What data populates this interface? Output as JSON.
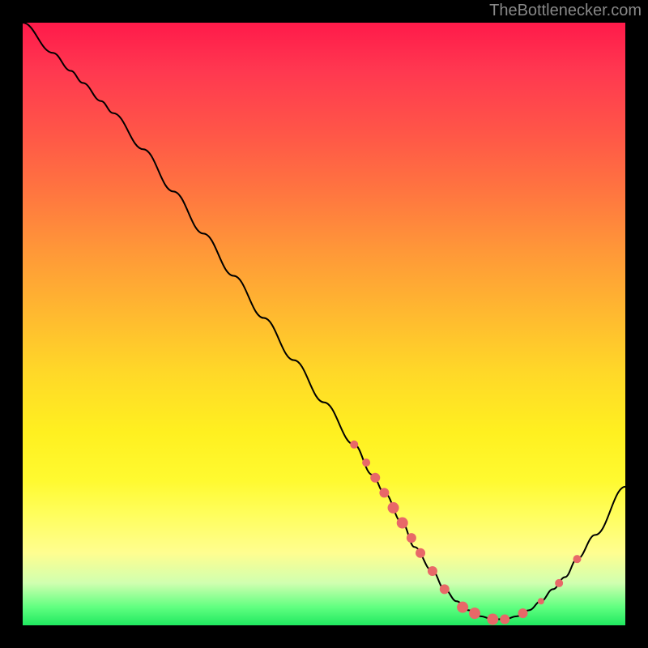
{
  "watermark": "TheBottlenecker.com",
  "chart_data": {
    "type": "line",
    "title": "",
    "xlabel": "",
    "ylabel": "",
    "xlim": [
      0,
      100
    ],
    "ylim": [
      0,
      100
    ],
    "curve_points": [
      {
        "x": 0,
        "y": 100
      },
      {
        "x": 5,
        "y": 95
      },
      {
        "x": 8,
        "y": 92
      },
      {
        "x": 10,
        "y": 90
      },
      {
        "x": 13,
        "y": 87
      },
      {
        "x": 15,
        "y": 85
      },
      {
        "x": 20,
        "y": 79
      },
      {
        "x": 25,
        "y": 72
      },
      {
        "x": 30,
        "y": 65
      },
      {
        "x": 35,
        "y": 58
      },
      {
        "x": 40,
        "y": 51
      },
      {
        "x": 45,
        "y": 44
      },
      {
        "x": 50,
        "y": 37
      },
      {
        "x": 55,
        "y": 30
      },
      {
        "x": 58,
        "y": 25
      },
      {
        "x": 60,
        "y": 22
      },
      {
        "x": 63,
        "y": 17
      },
      {
        "x": 65,
        "y": 13
      },
      {
        "x": 68,
        "y": 9
      },
      {
        "x": 70,
        "y": 6
      },
      {
        "x": 72,
        "y": 4
      },
      {
        "x": 74,
        "y": 2.5
      },
      {
        "x": 76,
        "y": 1.5
      },
      {
        "x": 78,
        "y": 1
      },
      {
        "x": 80,
        "y": 1
      },
      {
        "x": 82,
        "y": 1.5
      },
      {
        "x": 84,
        "y": 2.5
      },
      {
        "x": 86,
        "y": 4
      },
      {
        "x": 88,
        "y": 6
      },
      {
        "x": 90,
        "y": 8
      },
      {
        "x": 92,
        "y": 11
      },
      {
        "x": 95,
        "y": 15
      },
      {
        "x": 100,
        "y": 23
      }
    ],
    "data_points": [
      {
        "x": 55,
        "y": 30,
        "size": 5
      },
      {
        "x": 57,
        "y": 27,
        "size": 5
      },
      {
        "x": 58.5,
        "y": 24.5,
        "size": 6
      },
      {
        "x": 60,
        "y": 22,
        "size": 6
      },
      {
        "x": 61.5,
        "y": 19.5,
        "size": 7
      },
      {
        "x": 63,
        "y": 17,
        "size": 7
      },
      {
        "x": 64.5,
        "y": 14.5,
        "size": 6
      },
      {
        "x": 66,
        "y": 12,
        "size": 6
      },
      {
        "x": 68,
        "y": 9,
        "size": 6
      },
      {
        "x": 70,
        "y": 6,
        "size": 6
      },
      {
        "x": 73,
        "y": 3,
        "size": 7
      },
      {
        "x": 75,
        "y": 2,
        "size": 7
      },
      {
        "x": 78,
        "y": 1,
        "size": 7
      },
      {
        "x": 80,
        "y": 1,
        "size": 6
      },
      {
        "x": 83,
        "y": 2,
        "size": 6
      },
      {
        "x": 86,
        "y": 4,
        "size": 4
      },
      {
        "x": 89,
        "y": 7,
        "size": 5
      },
      {
        "x": 92,
        "y": 11,
        "size": 5
      }
    ]
  }
}
